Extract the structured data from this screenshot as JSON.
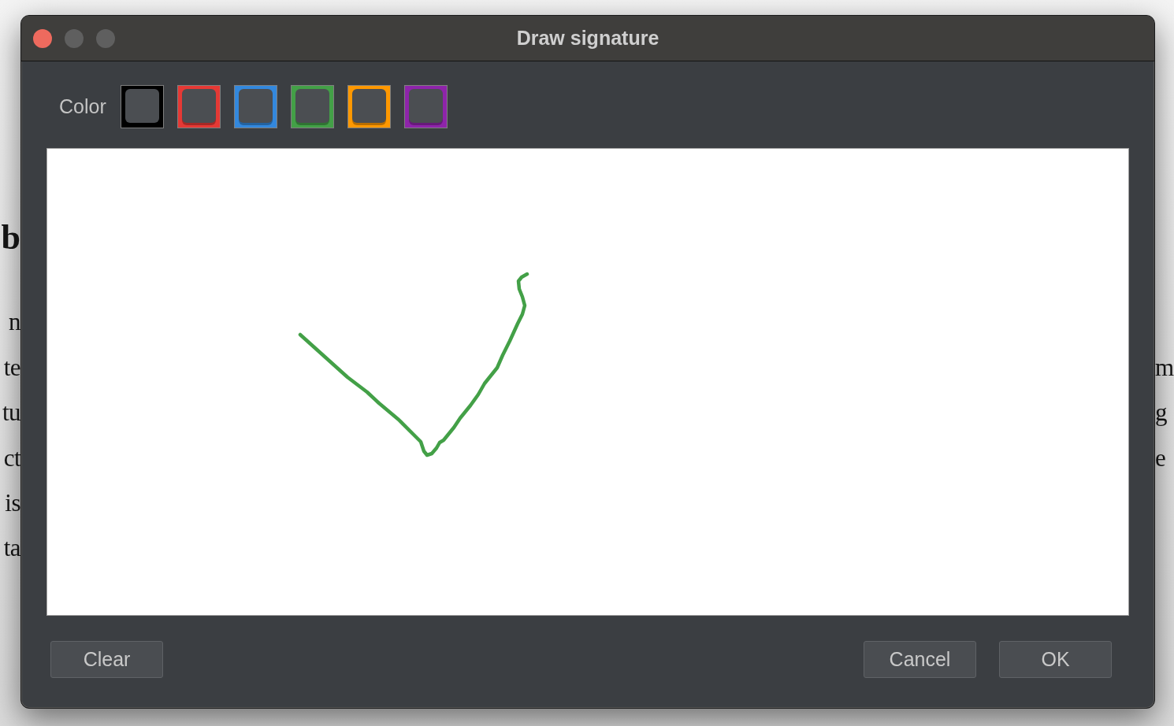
{
  "background_document": {
    "heading": "b",
    "lines": [
      {
        "left": "n"
      },
      {
        "left": "te",
        "right": "m"
      },
      {
        "left": "tu",
        "right": "g"
      },
      {
        "left": "ct",
        "right": "e"
      },
      {
        "left": "is"
      },
      {
        "left": "ta"
      }
    ]
  },
  "window": {
    "title": "Draw signature",
    "controls": [
      {
        "kind": "close",
        "disabled": false
      },
      {
        "kind": "minimize",
        "disabled": true
      },
      {
        "kind": "zoom",
        "disabled": true
      }
    ]
  },
  "color_picker": {
    "label": "Color",
    "swatches": [
      {
        "color": "#000000"
      },
      {
        "color": "#e53935"
      },
      {
        "color": "#3388dd"
      },
      {
        "color": "#43a047"
      },
      {
        "color": "#ff9800"
      },
      {
        "color": "#8e24aa"
      }
    ]
  },
  "left_buttons": [
    "Clear"
  ],
  "right_buttons": [
    "Cancel",
    "OK"
  ]
}
